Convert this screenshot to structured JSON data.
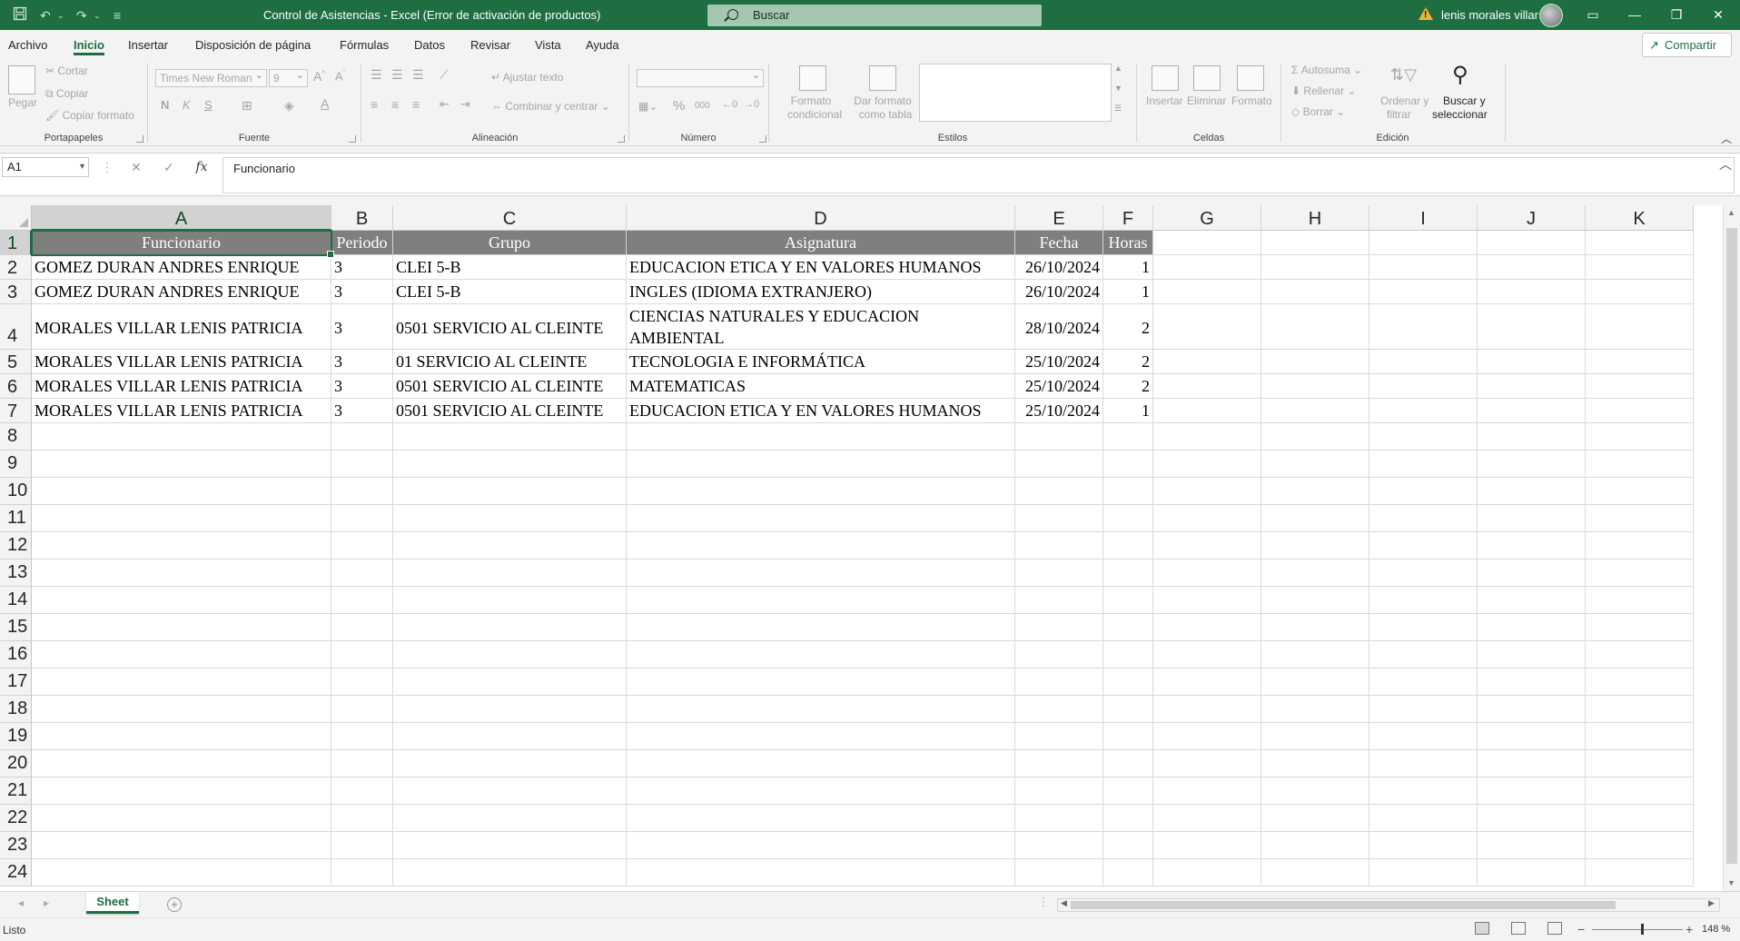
{
  "titlebar": {
    "title": "Control de Asistencias  -  Excel (Error de activación de productos)",
    "search_placeholder": "Buscar",
    "user_name": "lenis morales villar"
  },
  "tabs": [
    "Archivo",
    "Inicio",
    "Insertar",
    "Disposición de página",
    "Fórmulas",
    "Datos",
    "Revisar",
    "Vista",
    "Ayuda"
  ],
  "active_tab": "Inicio",
  "share_label": "Compartir",
  "ribbon": {
    "clipboard": {
      "paste": "Pegar",
      "cut": "Cortar",
      "copy": "Copiar",
      "format_painter": "Copiar formato",
      "label": "Portapapeles"
    },
    "font": {
      "name": "Times New Roman",
      "size": "9",
      "bold": "N",
      "italic": "K",
      "underline": "S",
      "label": "Fuente"
    },
    "alignment": {
      "wrap": "Ajustar texto",
      "merge": "Combinar y centrar",
      "label": "Alineación"
    },
    "number": {
      "format": "",
      "percent": "%",
      "thousands": "000",
      "label": "Número"
    },
    "styles": {
      "conditional_1": "Formato",
      "conditional_2": "condicional",
      "table_1": "Dar formato",
      "table_2": "como tabla",
      "label": "Estilos"
    },
    "cells": {
      "insert": "Insertar",
      "delete": "Eliminar",
      "format": "Formato",
      "label": "Celdas"
    },
    "editing": {
      "autosum": "Autosuma",
      "fill": "Rellenar",
      "clear": "Borrar",
      "sort_1": "Ordenar y",
      "sort_2": "filtrar",
      "find_1": "Buscar y",
      "find_2": "seleccionar",
      "label": "Edición"
    }
  },
  "formula_bar": {
    "name_box": "A1",
    "formula": "Funcionario"
  },
  "columns": [
    "A",
    "B",
    "C",
    "D",
    "E",
    "F",
    "G",
    "H",
    "I",
    "J",
    "K"
  ],
  "rows": [
    "1",
    "2",
    "3",
    "4",
    "5",
    "6",
    "7",
    "8",
    "9",
    "10",
    "11",
    "12",
    "13",
    "14",
    "15",
    "16",
    "17",
    "18",
    "19",
    "20",
    "21",
    "22",
    "23",
    "24"
  ],
  "table": {
    "headers": [
      "Funcionario",
      "Periodo",
      "Grupo",
      "Asignatura",
      "Fecha",
      "Horas"
    ],
    "rows": [
      [
        "GOMEZ DURAN ANDRES ENRIQUE",
        "3",
        "CLEI 5-B",
        "EDUCACION ETICA Y EN VALORES HUMANOS",
        "26/10/2024",
        "1"
      ],
      [
        "GOMEZ DURAN ANDRES ENRIQUE",
        "3",
        "CLEI 5-B",
        "INGLES  (IDIOMA  EXTRANJERO)",
        "26/10/2024",
        "1"
      ],
      [
        "MORALES VILLAR LENIS PATRICIA",
        "3",
        "0501 SERVICIO AL CLEINTE",
        "CIENCIAS NATURALES Y EDUCACION AMBIENTAL",
        "28/10/2024",
        "2"
      ],
      [
        "MORALES VILLAR LENIS PATRICIA",
        "3",
        "01 SERVICIO AL CLEINTE",
        "TECNOLOGIA E INFORMÁTICA",
        "25/10/2024",
        "2"
      ],
      [
        "MORALES VILLAR LENIS PATRICIA",
        "3",
        "0501 SERVICIO AL CLEINTE",
        "MATEMATICAS",
        "25/10/2024",
        "2"
      ],
      [
        "MORALES VILLAR LENIS PATRICIA",
        "3",
        "0501 SERVICIO AL CLEINTE",
        "EDUCACION ETICA Y EN VALORES HUMANOS",
        "25/10/2024",
        "1"
      ]
    ]
  },
  "sheet_tab": "Sheet",
  "status": {
    "ready": "Listo",
    "zoom": "148 %"
  },
  "colors": {
    "excel_green": "#1e6e42",
    "header_fill": "#7f7f7f"
  }
}
